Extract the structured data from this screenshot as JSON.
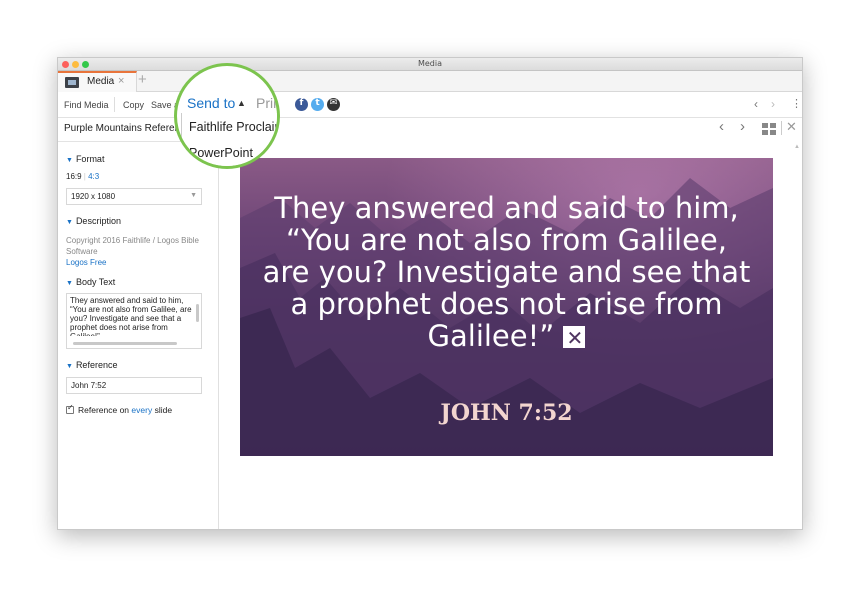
{
  "window": {
    "title": "Media"
  },
  "tab": {
    "label": "Media",
    "close": "×",
    "add": "+"
  },
  "toolbar": {
    "find_media": "Find Media",
    "copy": "Copy",
    "save": "Save a",
    "send_to": "Send to",
    "send_caret": "▲",
    "print": "Print",
    "back": "‹",
    "forward": "›",
    "more": "⋮"
  },
  "send_menu": {
    "items": [
      "Faithlife Proclaim",
      "PowerPoint"
    ]
  },
  "social": {
    "icons": [
      "evernote-icon",
      "facebook-icon",
      "twitter-icon",
      "email-icon"
    ],
    "colors": {
      "evernote": "#6fc043",
      "facebook": "#3b5998",
      "twitter": "#55acee",
      "email": "#333333"
    }
  },
  "sidebar": {
    "title": "Purple Mountains Reference",
    "format": {
      "heading": "Format",
      "ratio_active": "16:9",
      "ratio_alt": "4:3",
      "resolution": "1920 x 1080"
    },
    "description": {
      "heading": "Description",
      "copyright": "Copyright 2016 Faithlife / Logos Bible Software",
      "link": "Logos Free"
    },
    "body_text": {
      "heading": "Body Text",
      "value": "They answered and said to him, “You are not also from Galilee, are you? Investigate and see that a prophet does not arise from Galilee!”"
    },
    "reference": {
      "heading": "Reference",
      "value": "John 7:52"
    },
    "reference_every": {
      "prefix": "Reference on ",
      "highlight": "every",
      "suffix": " slide",
      "checked": true
    }
  },
  "content_nav": {
    "prev": "‹",
    "next": "›",
    "close": "✕"
  },
  "slide": {
    "text": "They answered and said to him, “You are not also from Galilee, are you? Investigate and see that a prophet does not arise from Galilee!”",
    "reference": "JOHN 7:52"
  },
  "colors": {
    "accent": "#1a72c6",
    "highlight_ring": "#7cc44e",
    "tab_accent": "#e8743b"
  }
}
